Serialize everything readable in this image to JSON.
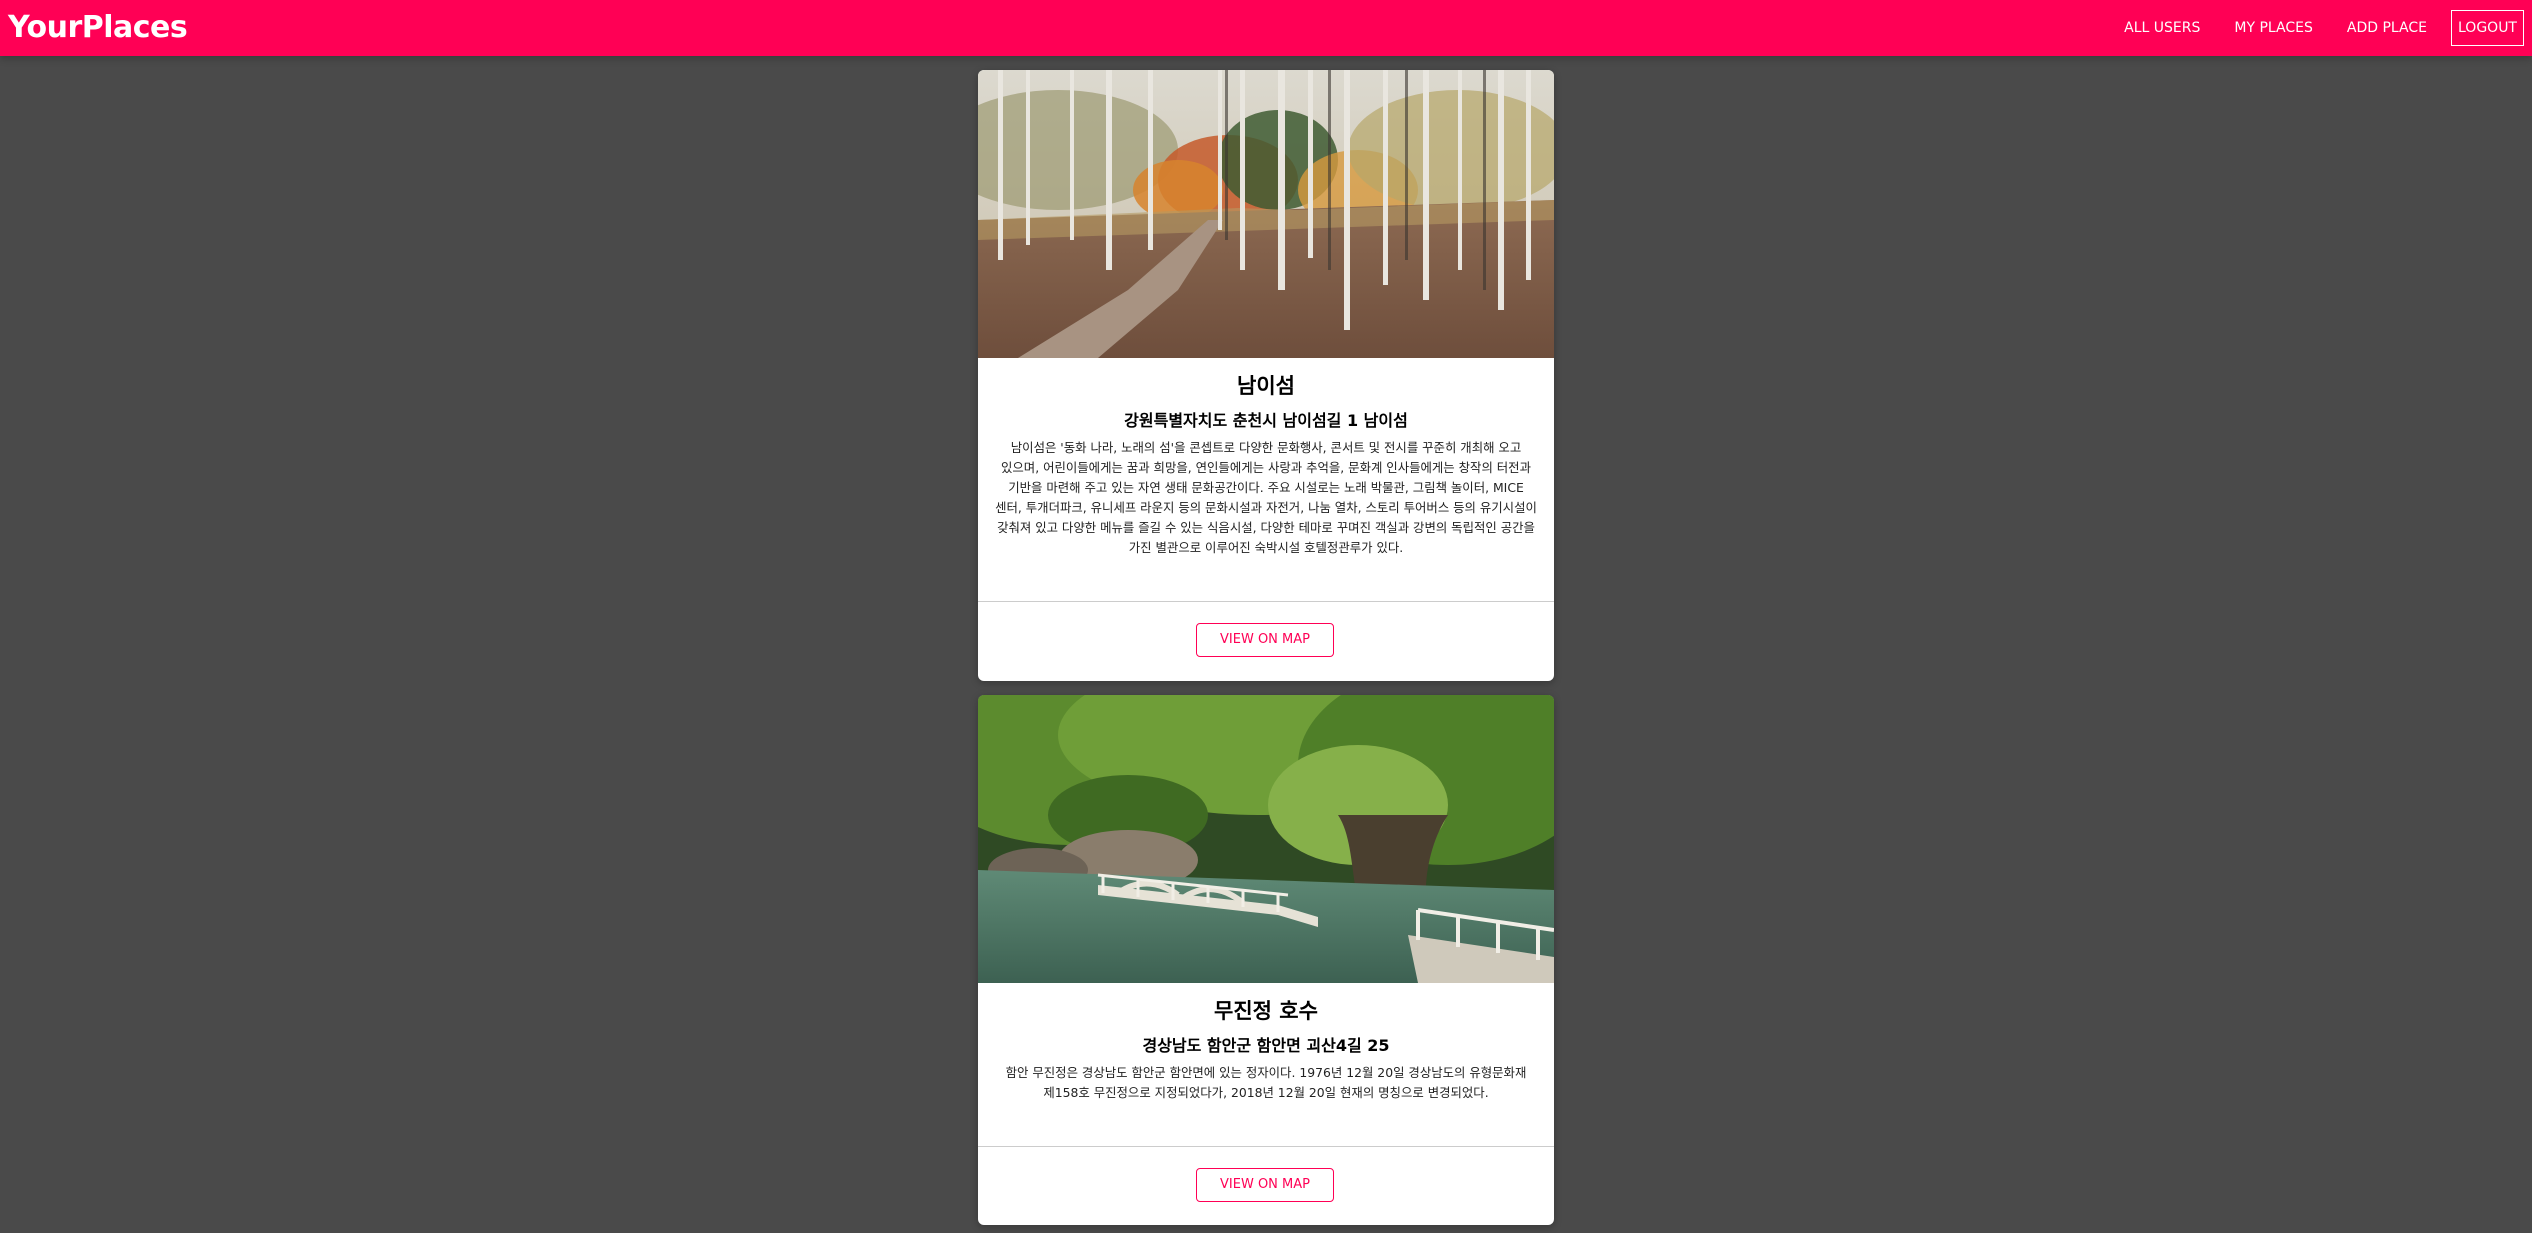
{
  "header": {
    "logo": "YourPlaces",
    "nav": {
      "all_users": "ALL USERS",
      "my_places": "MY PLACES",
      "add_place": "ADD PLACE",
      "logout": "LOGOUT"
    }
  },
  "colors": {
    "brand": "#ff0055",
    "page_background": "#4a4a4a",
    "card_background": "#ffffff"
  },
  "places": [
    {
      "title": "남이섬",
      "address": "강원특별자치도 춘천시 남이섬길 1 남이섬",
      "description": "남이섬은 '동화 나라, 노래의 섬'을 콘셉트로 다양한 문화행사, 콘서트 및 전시를 꾸준히 개최해 오고 있으며, 어린이들에게는 꿈과 희망을, 연인들에게는 사랑과 추억을, 문화계 인사들에게는 창작의 터전과 기반을 마련해 주고 있는 자연 생태 문화공간이다. 주요 시설로는 노래 박물관, 그림책 놀이터, MICE 센터, 투개더파크, 유니세프 라운지 등의 문화시설과 자전거, 나눔 열차, 스토리 투어버스 등의 유기시설이 갖춰져 있고 다양한 메뉴를 즐길 수 있는 식음시설, 다양한 테마로 꾸며진 객실과 강변의 독립적인 공간을 가진 별관으로 이루어진 숙박시설 호텔정관루가 있다.",
      "button": "VIEW ON MAP",
      "image_alt": "autumn birch forest path"
    },
    {
      "title": "무진정 호수",
      "address": "경상남도 함안군 함안면 괴산4길 25",
      "description": "함안 무진정은 경상남도 함안군 함안면에 있는 정자이다. 1976년 12월 20일 경상남도의 유형문화재 제158호 무진정으로 지정되었다가, 2018년 12월 20일 현재의 명칭으로 변경되었다.",
      "button": "VIEW ON MAP",
      "image_alt": "stone bridge over pond with large tree"
    }
  ]
}
